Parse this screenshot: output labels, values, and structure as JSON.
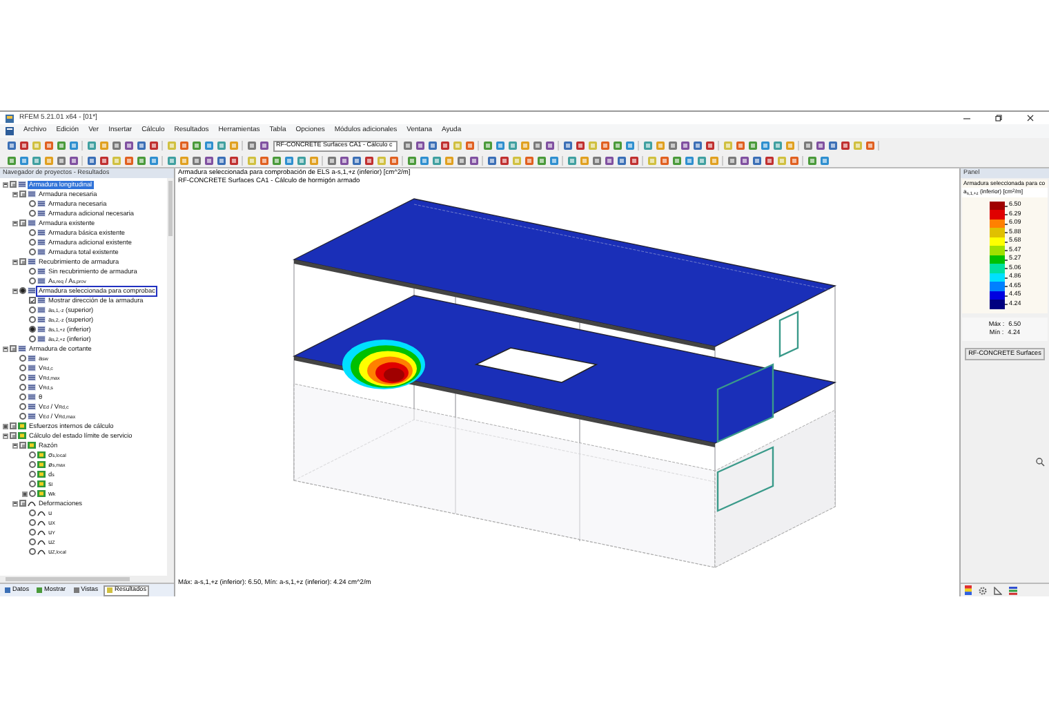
{
  "window": {
    "title": "RFEM 5.21.01 x64 - [01*]"
  },
  "menu": [
    "Archivo",
    "Edición",
    "Ver",
    "Insertar",
    "Cálculo",
    "Resultados",
    "Herramientas",
    "Tabla",
    "Opciones",
    "Módulos adicionales",
    "Ventana",
    "Ayuda"
  ],
  "toolbar": {
    "case_dropdown": "RF-CONCRETE Surfaces CA1 - Cálculo c"
  },
  "navigator": {
    "title": "Navegador de proyectos - Resultados",
    "tree": [
      {
        "label": "Armadura longitudinal",
        "kind": "folder",
        "selected": true,
        "checked": true,
        "expanded": true,
        "children": [
          {
            "label": "Armadura necesaria",
            "kind": "folder",
            "selected": false,
            "checked": true,
            "expanded": true,
            "children": [
              {
                "label": "Armadura necesaria",
                "kind": "radio",
                "selected": false,
                "checked": false
              },
              {
                "label": "Armadura adicional necesaria",
                "kind": "radio",
                "selected": false,
                "checked": false
              }
            ]
          },
          {
            "label": "Armadura existente",
            "kind": "folder",
            "selected": false,
            "checked": true,
            "expanded": true,
            "children": [
              {
                "label": "Armadura básica existente",
                "kind": "radio",
                "selected": false,
                "checked": false
              },
              {
                "label": "Armadura adicional existente",
                "kind": "radio",
                "selected": false,
                "checked": false
              },
              {
                "label": "Armadura total existente",
                "kind": "radio",
                "selected": false,
                "checked": false
              }
            ]
          },
          {
            "label": "Recubrimiento de armadura",
            "kind": "folder",
            "selected": false,
            "checked": true,
            "expanded": true,
            "children": [
              {
                "label": "Sin recubrimiento de armadura",
                "kind": "radio",
                "selected": false,
                "checked": false
              },
              {
                "label": "A$_{s,req}$ / A$_{s,prov}$",
                "kind": "radio",
                "selected": false,
                "checked": false
              }
            ]
          },
          {
            "label": "Armadura seleccionada para comprobac",
            "kind": "radio",
            "selected": false,
            "checked": true,
            "focused": true,
            "expanded": true,
            "children": [
              {
                "label": "Mostrar dirección de la armadura",
                "kind": "check",
                "selected": false,
                "checked": true
              },
              {
                "label": "a$_{s,1,-z}$ (superior)",
                "kind": "radio",
                "selected": false,
                "checked": false
              },
              {
                "label": "a$_{s,2,-z}$ (superior)",
                "kind": "radio",
                "selected": false,
                "checked": false
              },
              {
                "label": "a$_{s,1,+z}$ (inferior)",
                "kind": "radio",
                "selected": false,
                "checked": true
              },
              {
                "label": "a$_{s,2,+z}$ (inferior)",
                "kind": "radio",
                "selected": false,
                "checked": false
              }
            ]
          }
        ]
      },
      {
        "label": "Armadura de cortante",
        "kind": "folder",
        "selected": false,
        "checked": true,
        "expanded": true,
        "children": [
          {
            "label": "a$_{sw}$",
            "kind": "radio",
            "selected": false,
            "checked": false
          },
          {
            "label": "V$_{Rd,c}$",
            "kind": "radio",
            "selected": false,
            "checked": false
          },
          {
            "label": "V$_{Rd,max}$",
            "kind": "radio",
            "selected": false,
            "checked": false
          },
          {
            "label": "V$_{Rd,s}$",
            "kind": "radio",
            "selected": false,
            "checked": false
          },
          {
            "label": "θ",
            "kind": "radio",
            "selected": false,
            "checked": false
          },
          {
            "label": "V$_{Ed}$ / V$_{Rd,c}$",
            "kind": "radio",
            "selected": false,
            "checked": false
          },
          {
            "label": "V$_{Ed}$ / V$_{Rd,max}$",
            "kind": "radio",
            "selected": false,
            "checked": false
          }
        ]
      },
      {
        "label": "Esfuerzos internos de cálculo",
        "kind": "folder",
        "selected": false,
        "checked": true,
        "expanded": false
      },
      {
        "label": "Cálculo del estado límite de servicio",
        "kind": "folder",
        "selected": false,
        "checked": true,
        "expanded": true,
        "children": [
          {
            "label": "Razón",
            "kind": "folder",
            "selected": false,
            "checked": true,
            "expanded": true,
            "children": [
              {
                "label": "σ$_{s,local}$",
                "kind": "radio",
                "selected": false,
                "checked": false
              },
              {
                "label": "ø$_{s,max}$",
                "kind": "radio",
                "selected": false,
                "checked": false
              },
              {
                "label": "d$_{s}$",
                "kind": "radio",
                "selected": false,
                "checked": false
              },
              {
                "label": "s$_{l}$",
                "kind": "radio",
                "selected": false,
                "checked": false
              },
              {
                "label": "w$_{k}$",
                "kind": "radio",
                "selected": false,
                "checked": false,
                "expanded": false
              }
            ]
          },
          {
            "label": "Deformaciones",
            "kind": "folder",
            "selected": false,
            "checked": true,
            "expanded": true,
            "children": [
              {
                "label": "u",
                "kind": "radio",
                "selected": false,
                "checked": false
              },
              {
                "label": "u$_{X}$",
                "kind": "radio",
                "selected": false,
                "checked": false
              },
              {
                "label": "u$_{Y}$",
                "kind": "radio",
                "selected": false,
                "checked": false
              },
              {
                "label": "u$_{Z}$",
                "kind": "radio",
                "selected": false,
                "checked": false
              },
              {
                "label": "u$_{Z,local}$",
                "kind": "radio",
                "selected": false,
                "checked": false
              }
            ]
          }
        ]
      }
    ],
    "tabs": [
      {
        "label": "Datos",
        "selected": false
      },
      {
        "label": "Mostrar",
        "selected": false
      },
      {
        "label": "Vistas",
        "selected": false
      },
      {
        "label": "Resultados",
        "selected": true
      }
    ]
  },
  "view": {
    "header": [
      "Armadura seleccionada para comprobación de ELS a-s,1,+z (inferior) [cm^2/m]",
      "RF-CONCRETE Surfaces CA1 - Cálculo de hormigón armado"
    ],
    "status": "Máx: a-s,1,+z (inferior): 6.50, Mín: a-s,1,+z (inferior): 4.24 cm^2/m"
  },
  "panel": {
    "title": "Panel",
    "heading": "Armadura seleccionada para co",
    "unit": "a$_{s,1,+z}$ (inferior) [cm$^{2}$/m]",
    "legend": [
      {
        "value": "6.50",
        "color": "#a00000"
      },
      {
        "value": "6.29",
        "color": "#e00000"
      },
      {
        "value": "6.09",
        "color": "#ff8000"
      },
      {
        "value": "5.88",
        "color": "#e0c000"
      },
      {
        "value": "5.68",
        "color": "#ffff00"
      },
      {
        "value": "5.47",
        "color": "#a0e000"
      },
      {
        "value": "5.27",
        "color": "#00c000"
      },
      {
        "value": "5.06",
        "color": "#00e0a0"
      },
      {
        "value": "4.86",
        "color": "#00e0ff"
      },
      {
        "value": "4.65",
        "color": "#0080ff"
      },
      {
        "value": "4.45",
        "color": "#0000e0"
      },
      {
        "value": "4.24",
        "color": "#000080"
      }
    ],
    "max_label": "Máx :",
    "max": "6.50",
    "min_label": "Mín :",
    "min": "4.24",
    "button": "RF-CONCRETE Surfaces"
  }
}
